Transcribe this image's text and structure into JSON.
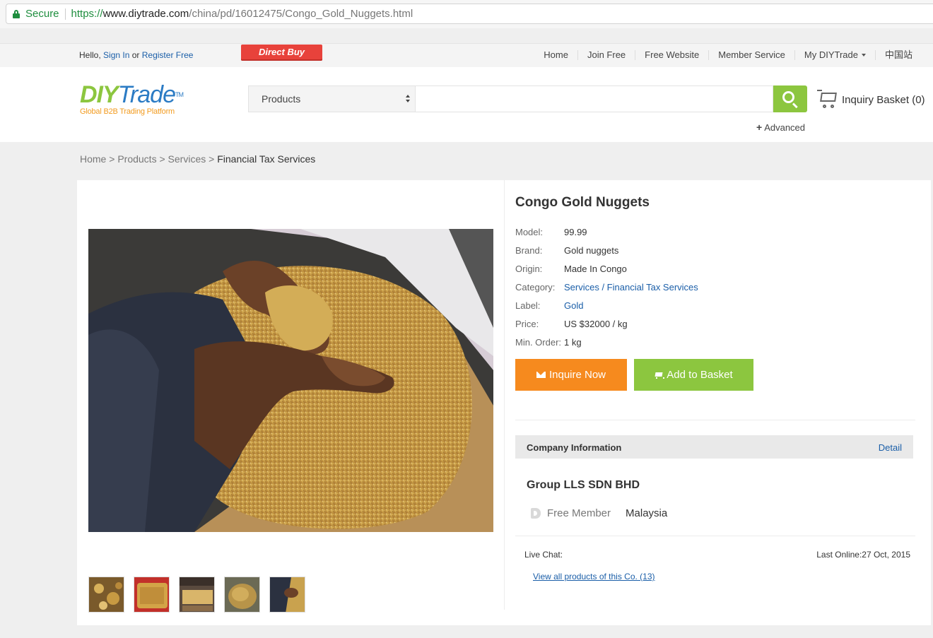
{
  "browser": {
    "secure_label": "Secure",
    "url_scheme": "https://",
    "url_host": "www.diytrade.com",
    "url_path": "/china/pd/16012475/Congo_Gold_Nuggets.html"
  },
  "topnav": {
    "hello": "Hello,",
    "sign_in": "Sign In",
    "or": "or",
    "register": "Register Free",
    "direct_buy": "Direct Buy",
    "links": [
      "Home",
      "Join Free",
      "Free Website",
      "Member Service",
      "My DIYTrade",
      "中国站"
    ]
  },
  "header": {
    "logo_diy": "DIY",
    "logo_trade": "Trade",
    "logo_tm": "TM",
    "logo_tagline": "Global B2B Trading Platform",
    "search_category": "Products",
    "search_value": "",
    "inquiry_basket": "Inquiry Basket (0)",
    "advanced": "Advanced"
  },
  "breadcrumb": [
    "Home",
    "Products",
    "Services",
    "Financial Tax Services"
  ],
  "product": {
    "title": "Congo Gold Nuggets",
    "specs": [
      {
        "key": "Model:",
        "value": "99.99",
        "link": false
      },
      {
        "key": "Brand:",
        "value": "Gold nuggets",
        "link": false
      },
      {
        "key": "Origin:",
        "value": "Made In Congo",
        "link": false
      },
      {
        "key": "Category:",
        "value": "Services / Financial Tax Services",
        "link": true
      },
      {
        "key": "Label:",
        "value": "Gold",
        "link": true
      },
      {
        "key": "Price:",
        "value": "US $32000 / kg",
        "link": false
      },
      {
        "key": "Min. Order:",
        "value": "1 kg",
        "link": false
      }
    ],
    "inquire_label": "Inquire Now",
    "add_basket_label": "Add to Basket"
  },
  "company": {
    "section_title": "Company Information",
    "detail_label": "Detail",
    "name": "Group LLS SDN BHD",
    "member_type": "Free Member",
    "country": "Malaysia",
    "live_chat": "Live Chat:",
    "last_online": "Last Online:27 Oct, 2015",
    "view_all": "View all products of this Co. (13)"
  },
  "colors": {
    "accent_green": "#8cc63f",
    "accent_orange": "#f68a1e",
    "direct_buy_red": "#e8423b",
    "link_blue": "#1a5ea8"
  }
}
